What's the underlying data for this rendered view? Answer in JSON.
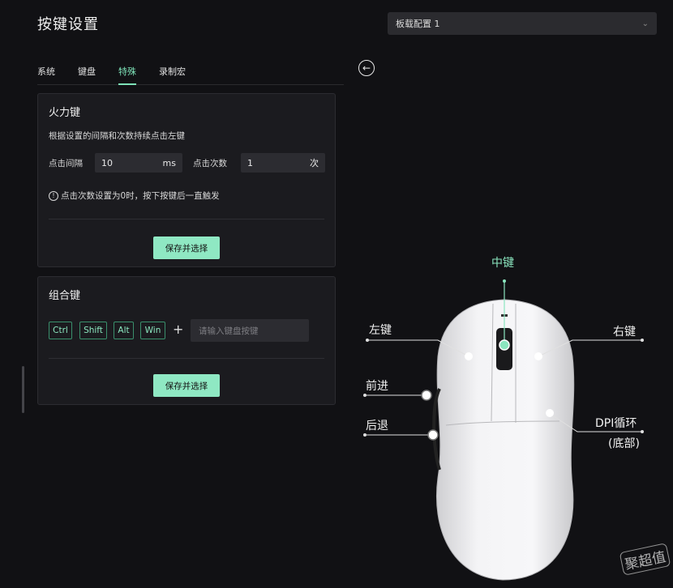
{
  "header": {
    "title": "按键设置",
    "profile_select": "板载配置 1"
  },
  "tabs": [
    {
      "label": "系统",
      "active": false
    },
    {
      "label": "键盘",
      "active": false
    },
    {
      "label": "特殊",
      "active": true
    },
    {
      "label": "录制宏",
      "active": false
    }
  ],
  "fire_key": {
    "title": "火力键",
    "description": "根据设置的间隔和次数持续点击左键",
    "interval_label": "点击间隔",
    "interval_value": "10",
    "interval_unit": "ms",
    "count_label": "点击次数",
    "count_value": "1",
    "count_unit": "次",
    "note": "点击次数设置为0时，按下按键后一直触发",
    "save_label": "保存并选择"
  },
  "combo_key": {
    "title": "组合键",
    "modifiers": [
      "Ctrl",
      "Shift",
      "Alt",
      "Win"
    ],
    "plus": "+",
    "input_placeholder": "请输入键盘按键",
    "save_label": "保存并选择"
  },
  "mouse_buttons": {
    "middle": "中键",
    "left": "左键",
    "right": "右键",
    "forward": "前进",
    "back": "后退",
    "dpi_line1": "DPI循环",
    "dpi_line2": "(底部)"
  },
  "watermark": "聚超值",
  "colors": {
    "accent": "#8be6bf",
    "background": "#111114",
    "panel": "#1b1b1f"
  }
}
